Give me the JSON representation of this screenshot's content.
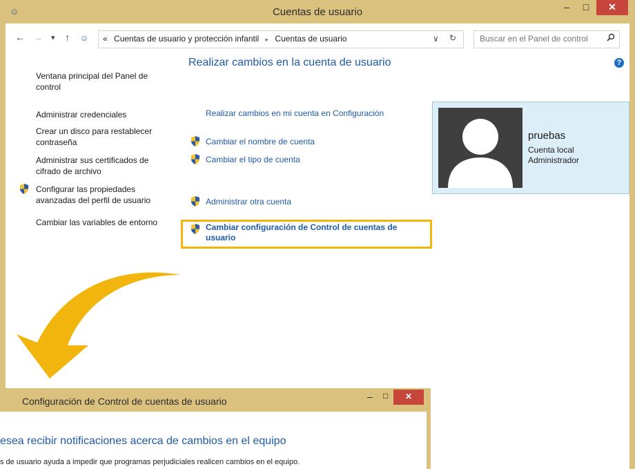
{
  "window": {
    "title": "Cuentas de usuario",
    "controls": {
      "minimize": "–",
      "maximize": "□",
      "close": "✕"
    }
  },
  "address_bar": {
    "back": "←",
    "forward": "→",
    "recent": "▾",
    "up": "↑",
    "overflow": "«",
    "breadcrumb": [
      "Cuentas de usuario y protección infantil",
      "Cuentas de usuario"
    ],
    "separator": "▸",
    "dropdown": "∨",
    "refresh": "↻"
  },
  "search": {
    "placeholder": "Buscar en el Panel de control",
    "icon": "search-icon"
  },
  "help": {
    "label": "?"
  },
  "left_nav": {
    "items": [
      "Ventana principal del Panel de control",
      "Administrar credenciales",
      "Crear un disco para restablecer contraseña",
      "Administrar sus certificados de cifrado de archivo",
      "Configurar las propiedades avanzadas del perfil de usuario",
      "Cambiar las variables de entorno"
    ]
  },
  "main": {
    "title": "Realizar cambios en la cuenta de usuario",
    "link_settings": "Realizar cambios en mi cuenta en Configuración",
    "link_rename": "Cambiar el nombre de cuenta",
    "link_type": "Cambiar el tipo de cuenta",
    "link_manage_other": "Administrar otra cuenta",
    "link_uac": "Cambiar configuración de Control de cuentas de usuario"
  },
  "user": {
    "name": "pruebas",
    "account_type": "Cuenta local",
    "role": "Administrador"
  },
  "uac_dialog": {
    "title": "Configuración de Control de cuentas de usuario",
    "heading": "esea recibir notificaciones acerca de cambios en el equipo",
    "text": "s de usuario ayuda a impedir que programas perjudiciales realicen cambios en el equipo.",
    "controls": {
      "minimize": "–",
      "maximize": "□",
      "close": "✕"
    }
  },
  "colors": {
    "titlebar": "#dbc17e",
    "close": "#c7463c",
    "link": "#1e5aa8",
    "highlight": "#f2b50d",
    "user_panel": "#dceef8"
  }
}
